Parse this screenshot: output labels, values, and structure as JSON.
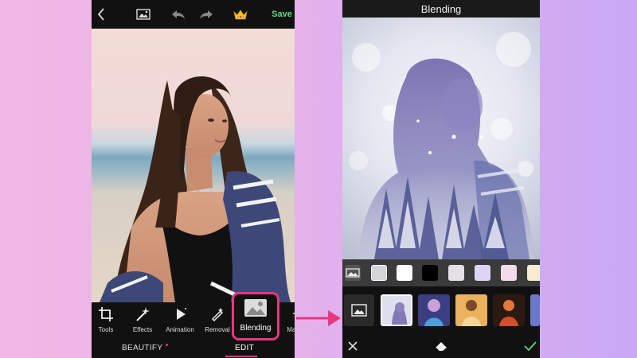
{
  "left_screen": {
    "topbar": {
      "save_label": "Save",
      "icons": [
        "back-chevron-icon",
        "gallery-icon",
        "undo-icon",
        "redo-icon",
        "crown-icon"
      ]
    },
    "tools": [
      {
        "label": "Tools",
        "icon": "crop-icon"
      },
      {
        "label": "Effects",
        "icon": "magic-wand-icon"
      },
      {
        "label": "Animation",
        "icon": "play-icon"
      },
      {
        "label": "Removal",
        "icon": "pen-icon"
      },
      {
        "label": "Blending",
        "icon": "blend-photo-icon",
        "selected": true
      },
      {
        "label": "Magic",
        "icon": "sparkle-icon"
      }
    ],
    "tabs": {
      "beautify": "BEAUTIFY",
      "edit": "EDIT"
    }
  },
  "right_screen": {
    "title": "Blending",
    "swatches": [
      "#ffffff",
      "#000000",
      "#e5e0e3",
      "#ddd6f2",
      "#f4dbe9",
      "#f6ecd2"
    ],
    "accent": "#5ed87b"
  },
  "colors": {
    "highlight": "#e8367f",
    "save": "#5ed87b"
  }
}
